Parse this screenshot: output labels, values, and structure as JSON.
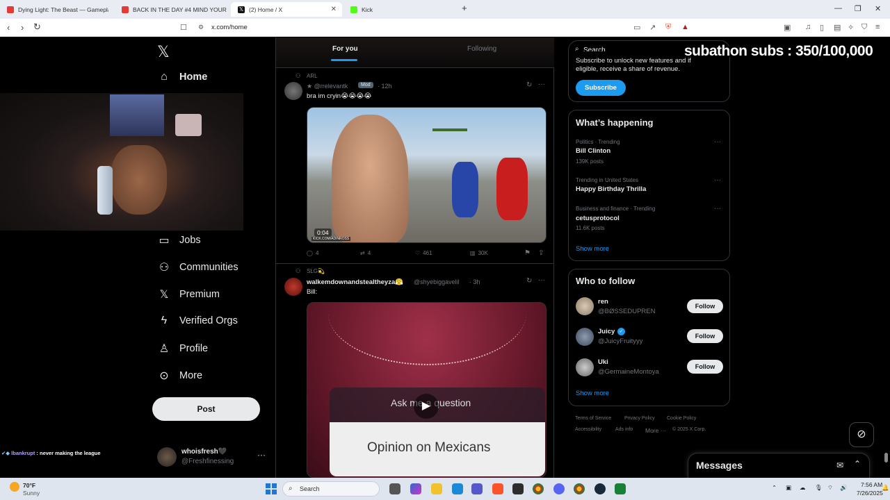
{
  "browser": {
    "tabs": [
      {
        "title": "Dying Light: The Beast — Gameplay",
        "color": "#e53935"
      },
      {
        "title": "BACK IN THE DAY #4 MIND YOUR C",
        "color": "#e53935"
      },
      {
        "title": "(2) Home / X",
        "color": "#111111"
      },
      {
        "title": "Kick",
        "color": "#53fc18"
      }
    ],
    "new_tab": "+",
    "url": "x.com/home"
  },
  "nav": {
    "home": "Home",
    "jobs": "Jobs",
    "communities": "Communities",
    "premium": "Premium",
    "verified_orgs": "Verified Orgs",
    "profile": "Profile",
    "more": "More",
    "post": "Post",
    "account_name": "whoisfresh🖤",
    "account_handle": "@Freshfinessing"
  },
  "feed": {
    "tab_for_you": "For you",
    "tab_following": "Following",
    "tweet1": {
      "community": "ARL",
      "handle": "★ @rrelevantk",
      "badge": "Mod",
      "time": "· 12h",
      "text": "bra im cryin😭😭😭😭",
      "duration": "0:04",
      "watermark": "KICK.COM/ADINROSS",
      "replies": "4",
      "reposts": "4",
      "likes": "461",
      "views": "30K"
    },
    "tweet2": {
      "community": "SLG💫",
      "name": "walkemdownandstealtheyza😤",
      "handle": "@shyebiggavelil",
      "time": "· 3h",
      "text": "Bill:",
      "overlay_question": "Ask me a question",
      "overlay_answer": "Opinion on Mexicans"
    }
  },
  "sidebar": {
    "search_placeholder": "Search",
    "premium_text_1": "Subscribe to unlock new features and if",
    "premium_text_2": "eligible, receive a share of revenue.",
    "subscribe": "Subscribe",
    "whats_happening": "What’s happening",
    "trends": [
      {
        "meta": "Politics · Trending",
        "title": "Bill Clinton",
        "count": "139K posts"
      },
      {
        "meta": "Trending in United States",
        "title": "Happy Birthday Thrilla",
        "count": ""
      },
      {
        "meta": "Business and finance · Trending",
        "title": "cetusprotocol",
        "count": "11.6K posts"
      }
    ],
    "show_more": "Show more",
    "who_to_follow": "Who to follow",
    "follow_label": "Follow",
    "suggestions": [
      {
        "name": "ren",
        "handle": "@BØSSEDUPREN"
      },
      {
        "name": "Juicy",
        "handle": "@JuicyFruityyy"
      },
      {
        "name": "Uki",
        "handle": "@GermaineMontoya"
      }
    ],
    "footer": [
      "Terms of Service",
      "Privacy Policy",
      "Cookie Policy",
      "Accessibility",
      "Ads info",
      "More ···",
      "© 2025 X Corp."
    ],
    "messages": "Messages"
  },
  "overlay": {
    "subathon": "subathon subs : 350/100,000",
    "chat_user": "lbankrupt",
    "chat_text": ": never making the league"
  },
  "taskbar": {
    "weather_temp": "70°F",
    "weather_desc": "Sunny",
    "search": "Search",
    "time": "7:56 AM",
    "date": "7/26/2025"
  }
}
